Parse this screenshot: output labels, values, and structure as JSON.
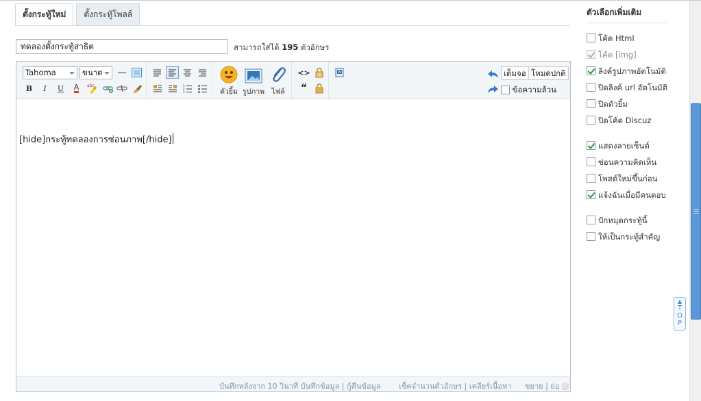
{
  "tabs": [
    {
      "label": "ตั้งกระทู้ใหม่",
      "active": true
    },
    {
      "label": "ตั้งกระทู้โพลล์",
      "active": false
    }
  ],
  "subject": {
    "value": "ทดลองตั้งกระทู้สาธิต",
    "hint_prefix": "สามารถใส่ได้",
    "hint_count": "195",
    "hint_suffix": "ตัวอักษร"
  },
  "toolbar": {
    "font_select": "Tahoma",
    "size_select": "ขนาด",
    "smiley_label": "ตัวยิ้ม",
    "image_label": "รูปภาพ",
    "attach_label": "ไฟล์",
    "fullscreen_label": "เต็มจอ",
    "normal_mode_label": "โหมดปกติ",
    "plain_text_label": "ข้อความล้วน",
    "bold": "B",
    "italic": "I",
    "underline": "U",
    "font_color": "A",
    "quote": "“",
    "code": "<>"
  },
  "editor": {
    "content": "[hide]กระทู้ทดลองการซ่อนภาพ[/hide]"
  },
  "statusbar": {
    "autosave": "บันทึกหลังจาก 10 วินาที บันทึกข้อมูล | กู้คืนข้อมูล",
    "tools": "เช็คจำนวนตัวอักษร | เคลียร์เนื้อหา",
    "resize": "ขยาย | ย่อ"
  },
  "options": {
    "title": "ตัวเลือกเพิ่มเติม",
    "items": [
      {
        "label": "โค้ด Html",
        "checked": false,
        "disabled": false
      },
      {
        "label": "โค้ด [img]",
        "checked": true,
        "disabled": true
      },
      {
        "label": "ลิงค์รูปภาพอัตโนมัติ",
        "checked": true,
        "disabled": false
      },
      {
        "label": "ปิดลิงค์ url อัตโนมัติ",
        "checked": false,
        "disabled": false
      },
      {
        "label": "ปิดตัวยิ้ม",
        "checked": false,
        "disabled": false
      },
      {
        "label": "ปิดโค้ด Discuz",
        "checked": false,
        "disabled": false
      },
      {
        "label": "แสดงลายเซ็นต์",
        "checked": true,
        "disabled": false
      },
      {
        "label": "ซ่อนความคิดเห็น",
        "checked": false,
        "disabled": false
      },
      {
        "label": "โพสต์ใหม่ขึ้นก่อน",
        "checked": false,
        "disabled": false
      },
      {
        "label": "แจ้งฉันเมื่อมีคนตอบ",
        "checked": true,
        "disabled": false
      },
      {
        "label": "ปักหมุดกระทู้นี้",
        "checked": false,
        "disabled": false
      },
      {
        "label": "ให้เป็นกระทู้สำคัญ",
        "checked": false,
        "disabled": false
      }
    ]
  },
  "top_button": "TOP",
  "colors": {
    "accent": "#5a98d6",
    "check": "#2a9a2a"
  }
}
